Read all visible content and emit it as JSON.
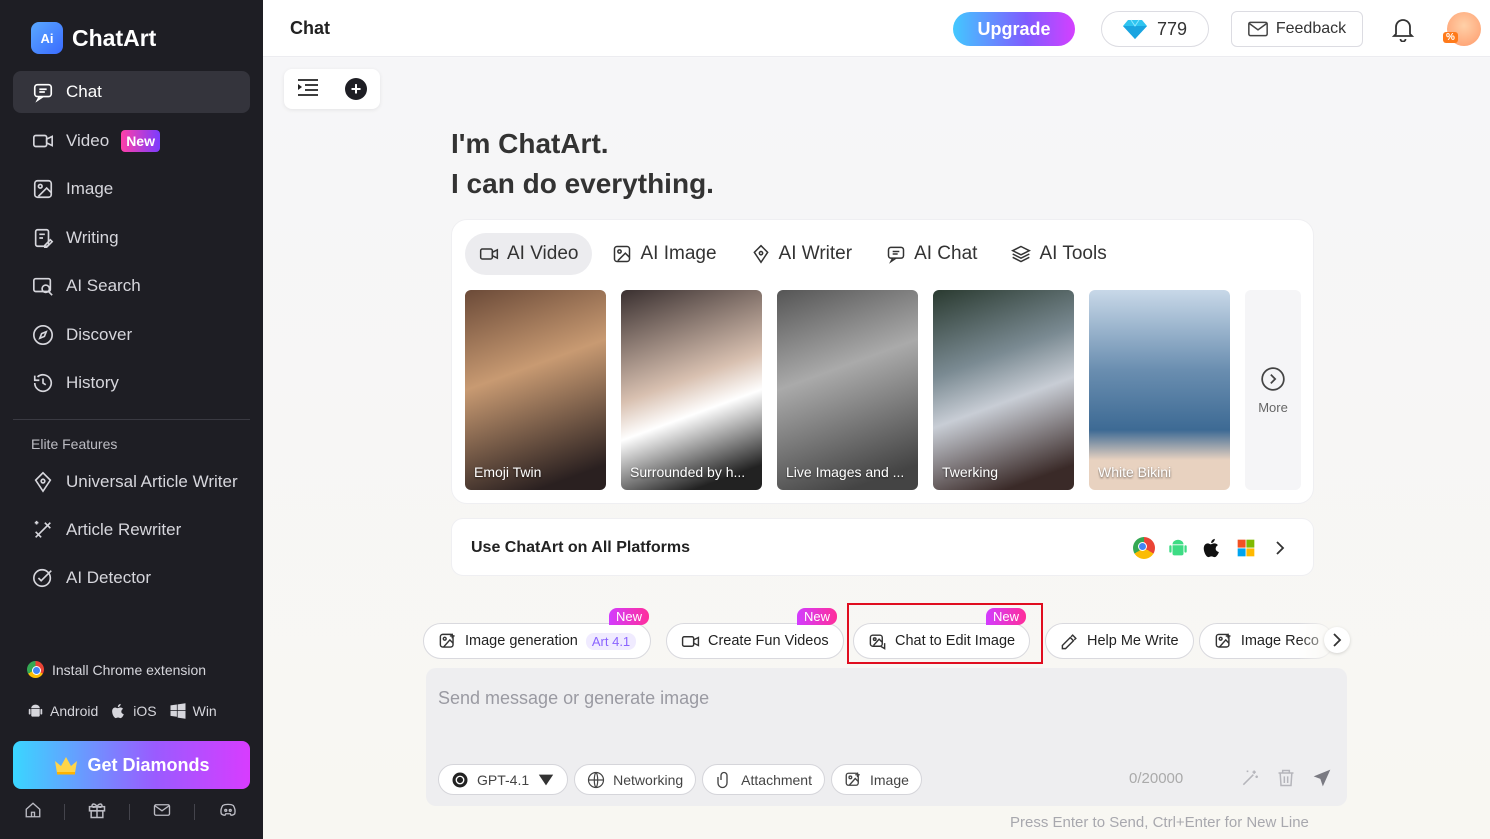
{
  "app": {
    "name": "ChatArt",
    "logo_mark": "Ai"
  },
  "sidebar": {
    "items": [
      {
        "label": "Chat",
        "icon": "chat-icon",
        "active": true
      },
      {
        "label": "Video",
        "icon": "video-icon",
        "badge": "New"
      },
      {
        "label": "Image",
        "icon": "image-icon"
      },
      {
        "label": "Writing",
        "icon": "writing-icon"
      },
      {
        "label": "AI Search",
        "icon": "ai-search-icon"
      },
      {
        "label": "Discover",
        "icon": "compass-icon"
      },
      {
        "label": "History",
        "icon": "history-icon"
      }
    ],
    "elite_title": "Elite Features",
    "elite_items": [
      {
        "label": "Universal Article Writer",
        "icon": "pen-icon"
      },
      {
        "label": "Article Rewriter",
        "icon": "rewrite-icon"
      },
      {
        "label": "AI Detector",
        "icon": "check-circle-icon"
      }
    ],
    "install_label": "Install Chrome extension",
    "platforms": {
      "android": "Android",
      "ios": "iOS",
      "win": "Win"
    },
    "get_diamonds": "Get Diamonds",
    "footer_icons": [
      "home-icon",
      "gift-icon",
      "mail-icon",
      "discord-icon"
    ]
  },
  "topbar": {
    "title": "Chat",
    "upgrade": "Upgrade",
    "diamonds": "779",
    "feedback": "Feedback"
  },
  "main": {
    "hero_line1": "I'm ChatArt.",
    "hero_line2": "I can do everything.",
    "tabs": [
      {
        "label": "AI Video",
        "icon": "video-icon",
        "active": true
      },
      {
        "label": "AI Image",
        "icon": "image-icon"
      },
      {
        "label": "AI Writer",
        "icon": "pen-icon"
      },
      {
        "label": "AI Chat",
        "icon": "chat-icon"
      },
      {
        "label": "AI Tools",
        "icon": "layers-icon"
      }
    ],
    "cards": [
      {
        "label": "Emoji Twin"
      },
      {
        "label": "Surrounded by h..."
      },
      {
        "label": "Live Images and ..."
      },
      {
        "label": "Twerking"
      },
      {
        "label": "White Bikini"
      }
    ],
    "more": "More",
    "platform_bar": "Use ChatArt on All Platforms",
    "chips": [
      {
        "label": "Image generation",
        "badge": "New",
        "extra": "Art 4.1"
      },
      {
        "label": "Create Fun Videos",
        "badge": "New"
      },
      {
        "label": "Chat to Edit Image",
        "badge": "New"
      },
      {
        "label": "Help Me Write"
      },
      {
        "label": "Image Reco"
      }
    ],
    "input": {
      "placeholder": "Send message or generate image",
      "model": "GPT-4.1",
      "networking": "Networking",
      "attachment": "Attachment",
      "image": "Image",
      "counter": "0/20000"
    },
    "hint": "Press Enter to Send, Ctrl+Enter for New Line"
  }
}
